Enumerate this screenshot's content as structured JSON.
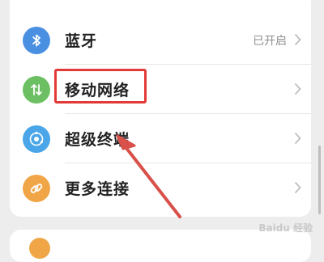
{
  "settings": {
    "rows": [
      {
        "label": "蓝牙",
        "status": "已开启",
        "icon": "bluetooth-icon",
        "icon_color": "#4a90e2"
      },
      {
        "label": "移动网络",
        "status": "",
        "icon": "mobile-data-icon",
        "icon_color": "#6cbf62"
      },
      {
        "label": "超级终端",
        "status": "",
        "icon": "super-device-icon",
        "icon_color": "#4aa6e8"
      },
      {
        "label": "更多连接",
        "status": "",
        "icon": "link-icon",
        "icon_color": "#f0a646"
      }
    ]
  },
  "annotation": {
    "highlight_color": "#e23a36",
    "arrow_color": "#d9504a"
  },
  "watermark": {
    "text": "Baidu 经验"
  }
}
